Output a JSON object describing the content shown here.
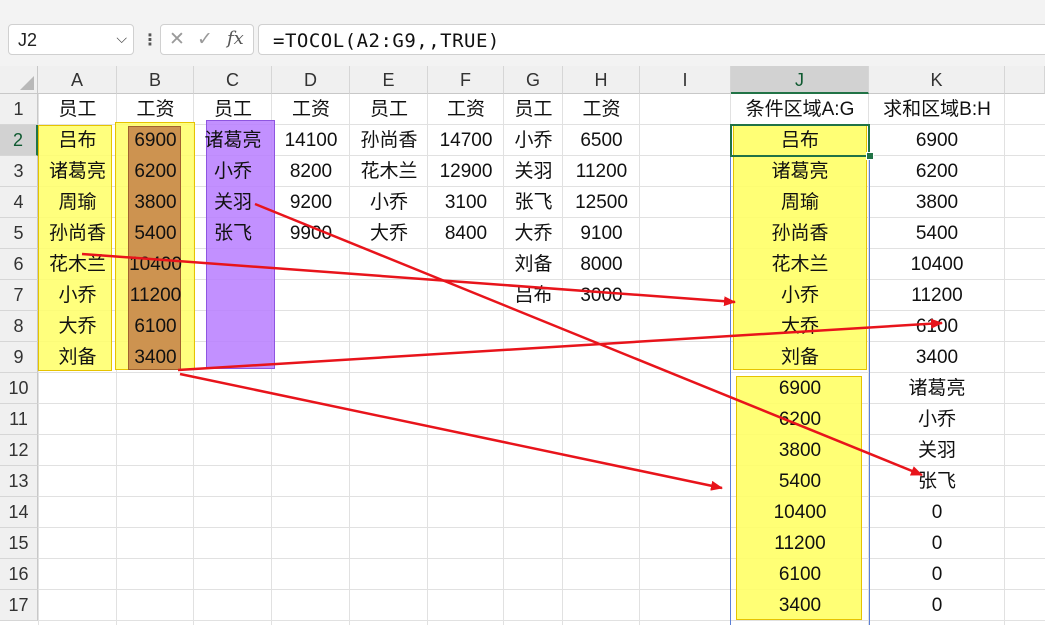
{
  "name_box": {
    "value": "J2"
  },
  "formula_bar": {
    "fx_label": "fx",
    "formula": "=TOCOL(A2:G9,,TRUE)"
  },
  "columns": [
    "A",
    "B",
    "C",
    "D",
    "E",
    "F",
    "G",
    "H",
    "I",
    "J",
    "K"
  ],
  "rows": [
    "1",
    "2",
    "3",
    "4",
    "5",
    "6",
    "7",
    "8",
    "9",
    "10",
    "11",
    "12",
    "13",
    "14",
    "15",
    "16",
    "17"
  ],
  "active_cell": "J2",
  "cells": {
    "r1": [
      "员工",
      "工资",
      "员工",
      "工资",
      "员工",
      "工资",
      "员工",
      "工资",
      "",
      "条件区域A:G",
      "求和区域B:H"
    ],
    "r2": [
      "吕布",
      "6900",
      "诸葛亮",
      "14100",
      "孙尚香",
      "14700",
      "小乔",
      "6500",
      "",
      "吕布",
      "6900"
    ],
    "r3": [
      "诸葛亮",
      "6200",
      "小乔",
      "8200",
      "花木兰",
      "12900",
      "关羽",
      "11200",
      "",
      "诸葛亮",
      "6200"
    ],
    "r4": [
      "周瑜",
      "3800",
      "关羽",
      "9200",
      "小乔",
      "3100",
      "张飞",
      "12500",
      "",
      "周瑜",
      "3800"
    ],
    "r5": [
      "孙尚香",
      "5400",
      "张飞",
      "9900",
      "大乔",
      "8400",
      "大乔",
      "9100",
      "",
      "孙尚香",
      "5400"
    ],
    "r6": [
      "花木兰",
      "10400",
      "",
      "",
      "",
      "",
      "刘备",
      "8000",
      "",
      "花木兰",
      "10400"
    ],
    "r7": [
      "小乔",
      "11200",
      "",
      "",
      "",
      "",
      "吕布",
      "3000",
      "",
      "小乔",
      "11200"
    ],
    "r8": [
      "大乔",
      "6100",
      "",
      "",
      "",
      "",
      "",
      "",
      "",
      "大乔",
      "6100"
    ],
    "r9": [
      "刘备",
      "3400",
      "",
      "",
      "",
      "",
      "",
      "",
      "",
      "刘备",
      "3400"
    ],
    "r10": [
      "",
      "",
      "",
      "",
      "",
      "",
      "",
      "",
      "",
      "6900",
      "诸葛亮"
    ],
    "r11": [
      "",
      "",
      "",
      "",
      "",
      "",
      "",
      "",
      "",
      "6200",
      "小乔"
    ],
    "r12": [
      "",
      "",
      "",
      "",
      "",
      "",
      "",
      "",
      "",
      "3800",
      "关羽"
    ],
    "r13": [
      "",
      "",
      "",
      "",
      "",
      "",
      "",
      "",
      "",
      "5400",
      "张飞"
    ],
    "r14": [
      "",
      "",
      "",
      "",
      "",
      "",
      "",
      "",
      "",
      "10400",
      "0"
    ],
    "r15": [
      "",
      "",
      "",
      "",
      "",
      "",
      "",
      "",
      "",
      "11200",
      "0"
    ],
    "r16": [
      "",
      "",
      "",
      "",
      "",
      "",
      "",
      "",
      "",
      "6100",
      "0"
    ],
    "r17": [
      "",
      "",
      "",
      "",
      "",
      "",
      "",
      "",
      "",
      "3400",
      "0"
    ]
  },
  "colors": {
    "highlight_yellow": "#ffff66",
    "highlight_brown": "#c8874f",
    "highlight_purple": "#b77cff",
    "arrow_red": "#e8141b",
    "accent_green": "#217346"
  },
  "icons": [
    "dropdown-chevron-icon",
    "more-options-icon",
    "cancel-x-icon",
    "confirm-check-icon",
    "fx-icon"
  ]
}
